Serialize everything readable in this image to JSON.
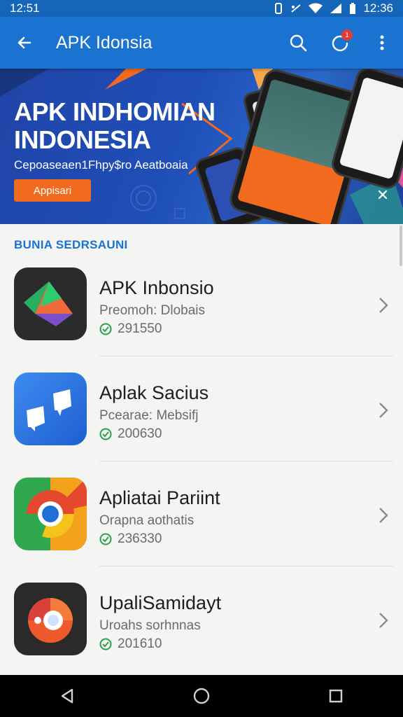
{
  "status": {
    "left_time": "12:51",
    "right_time": "12:36"
  },
  "appbar": {
    "title": "APK Idonsia",
    "notification_count": "1"
  },
  "banner": {
    "title_line1": "APK INDHOMIAN",
    "title_line2": "INDONESIA",
    "subtitle": "Cepoaseaen1Fhpy$ro Aeatboaia",
    "button_label": "Appisari",
    "colors": {
      "accent": "#f26a1e",
      "background": "#2044a8"
    }
  },
  "section": {
    "title": "BUNIA SEDRSAUNI"
  },
  "apps": [
    {
      "name": "APK Inbonsio",
      "subtitle": "Preomoh: Dlobais",
      "count": "291550",
      "icon": "colorful-arrow-icon"
    },
    {
      "name": "Aplak Sacius",
      "subtitle": "Pcearae: Mebsifj",
      "count": "200630",
      "icon": "chat-bubbles-icon"
    },
    {
      "name": "Apliatai Pariint",
      "subtitle": "Orapna aothatis",
      "count": "236330",
      "icon": "chrome-style-icon"
    },
    {
      "name": "UpaliSamidayt",
      "subtitle": "Uroahs sorhnnas",
      "count": "201610",
      "icon": "orange-lens-icon"
    }
  ]
}
